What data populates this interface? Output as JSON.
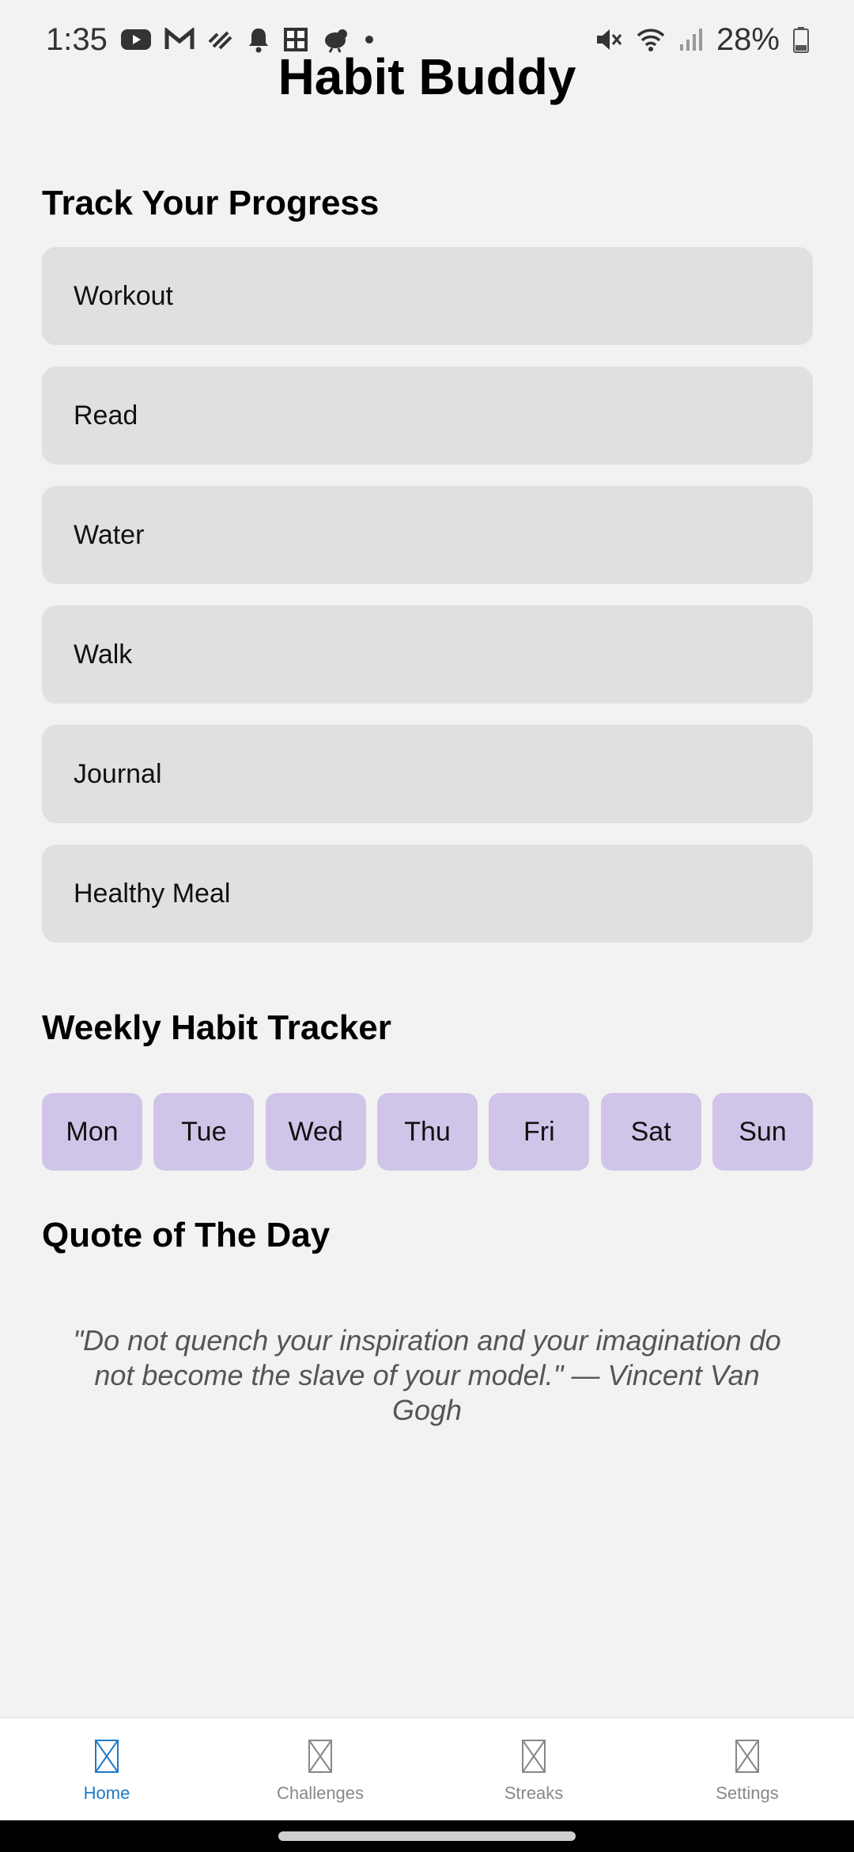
{
  "status_bar": {
    "time": "1:35",
    "battery": "28%",
    "icons_left": [
      "youtube-icon",
      "gmail-icon",
      "activity-icon",
      "bell-icon",
      "uniqlo-icon",
      "bird-icon",
      "dot-icon"
    ],
    "icons_right": [
      "mute-icon",
      "wifi-icon",
      "signal-icon",
      "battery-icon"
    ]
  },
  "app": {
    "title": "Habit Buddy"
  },
  "progress": {
    "heading": "Track Your Progress",
    "habits": [
      "Workout",
      "Read",
      "Water",
      "Walk",
      "Journal",
      "Healthy Meal"
    ]
  },
  "weekly": {
    "heading": "Weekly Habit Tracker",
    "days": [
      "Mon",
      "Tue",
      "Wed",
      "Thu",
      "Fri",
      "Sat",
      "Sun"
    ]
  },
  "quote": {
    "heading": "Quote of The Day",
    "text": "\"Do not quench your inspiration and your imagination do not become the slave of your model.\" — Vincent Van Gogh"
  },
  "nav": {
    "active": "Home",
    "items": [
      {
        "label": "Home",
        "icon": "placeholder-icon"
      },
      {
        "label": "Challenges",
        "icon": "placeholder-icon"
      },
      {
        "label": "Streaks",
        "icon": "placeholder-icon"
      },
      {
        "label": "Settings",
        "icon": "placeholder-icon"
      }
    ]
  },
  "colors": {
    "background": "#f2f2f2",
    "card": "#e0e0e0",
    "day_chip": "#d1c4e9",
    "nav_active": "#1f7ac8",
    "nav_inactive": "#888888"
  }
}
